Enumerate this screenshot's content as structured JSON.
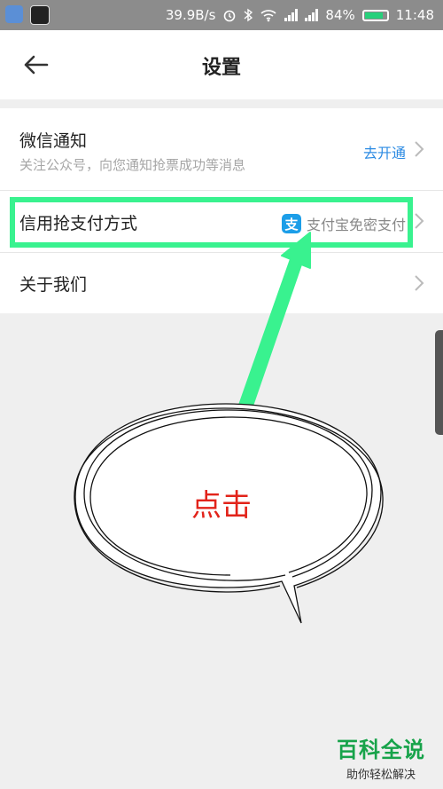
{
  "status_bar": {
    "net_speed": "39.9B/s",
    "battery": "84%",
    "battery_level": 0.84,
    "time": "11:48"
  },
  "header": {
    "title": "设置"
  },
  "settings": {
    "wechat": {
      "title": "微信通知",
      "subtitle": "关注公众号，向您通知抢票成功等消息",
      "action": "去开通"
    },
    "payment": {
      "title": "信用抢支付方式",
      "icon_glyph": "支",
      "value": "支付宝免密支付"
    },
    "about": {
      "title": "关于我们"
    }
  },
  "annotation": {
    "callout_text": "点击",
    "highlight_color": "#39f28f"
  },
  "colors": {
    "accent_link": "#2c8be3",
    "alipay_blue": "#1c9ee8",
    "callout_red": "#e2231a"
  },
  "watermark": {
    "main": "百科全说",
    "sub": "助你轻松解决"
  }
}
